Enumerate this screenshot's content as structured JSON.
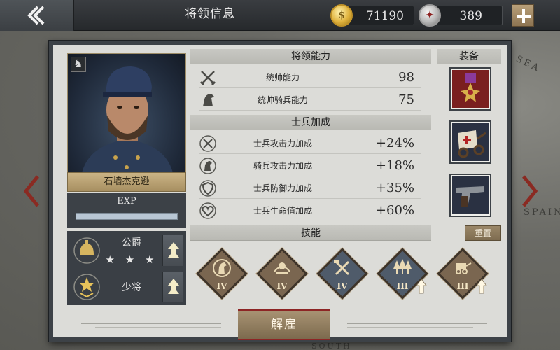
{
  "window": {
    "title": "将领信息"
  },
  "resources": {
    "gold": "71190",
    "medals": "389"
  },
  "map": {
    "labels": [
      "SEA",
      "SPAIN",
      "SOUTH"
    ]
  },
  "general": {
    "name": "石墙杰克逊",
    "exp_label": "EXP",
    "exp_progress": 1.0,
    "title_rank": "公爵",
    "title_stars": "★ ★ ★",
    "military_rank": "少将"
  },
  "command": {
    "header": "将领能力",
    "stats": [
      {
        "label": "统帅能力",
        "value": "98",
        "icon": "crossed-swords-icon"
      },
      {
        "label": "统帅骑兵能力",
        "value": "75",
        "icon": "horse-icon"
      }
    ]
  },
  "bonuses": {
    "header": "士兵加成",
    "stats": [
      {
        "label": "士兵攻击力加成",
        "value": "+24%",
        "icon": "attack-bonus-icon"
      },
      {
        "label": "骑兵攻击力加成",
        "value": "+18%",
        "icon": "cavalry-bonus-icon"
      },
      {
        "label": "士兵防御力加成",
        "value": "+35%",
        "icon": "defense-bonus-icon"
      },
      {
        "label": "士兵生命值加成",
        "value": "+60%",
        "icon": "health-bonus-icon"
      }
    ]
  },
  "equipment": {
    "header": "装备",
    "items": [
      "medal-icon",
      "ambulance-wagon-icon",
      "pistol-icon"
    ]
  },
  "skills": {
    "header": "技能",
    "reset_label": "重置",
    "items": [
      {
        "icon": "horse-emblem-skill-icon",
        "level": "IV",
        "upgrade": false
      },
      {
        "icon": "cavalry-charge-skill-icon",
        "level": "IV",
        "upgrade": false
      },
      {
        "icon": "crossed-weapons-skill-icon",
        "level": "IV",
        "upgrade": false
      },
      {
        "icon": "forest-skill-icon",
        "level": "III",
        "upgrade": true
      },
      {
        "icon": "wagon-skill-icon",
        "level": "III",
        "upgrade": true
      }
    ]
  },
  "actions": {
    "dismiss_label": "解雇"
  }
}
